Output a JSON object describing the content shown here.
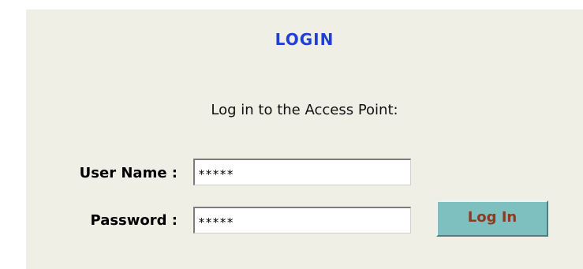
{
  "login": {
    "title": "LOGIN",
    "subtitle": "Log in to the Access Point:",
    "username_label": "User Name :",
    "username_value": "*****",
    "password_label": "Password :",
    "password_value": "*****",
    "button_label": "Log In"
  },
  "colors": {
    "panel_background": "#efefe6",
    "title_color": "#1f3fd6",
    "button_background": "#7ebfc0",
    "button_text": "#8b3b1f"
  }
}
